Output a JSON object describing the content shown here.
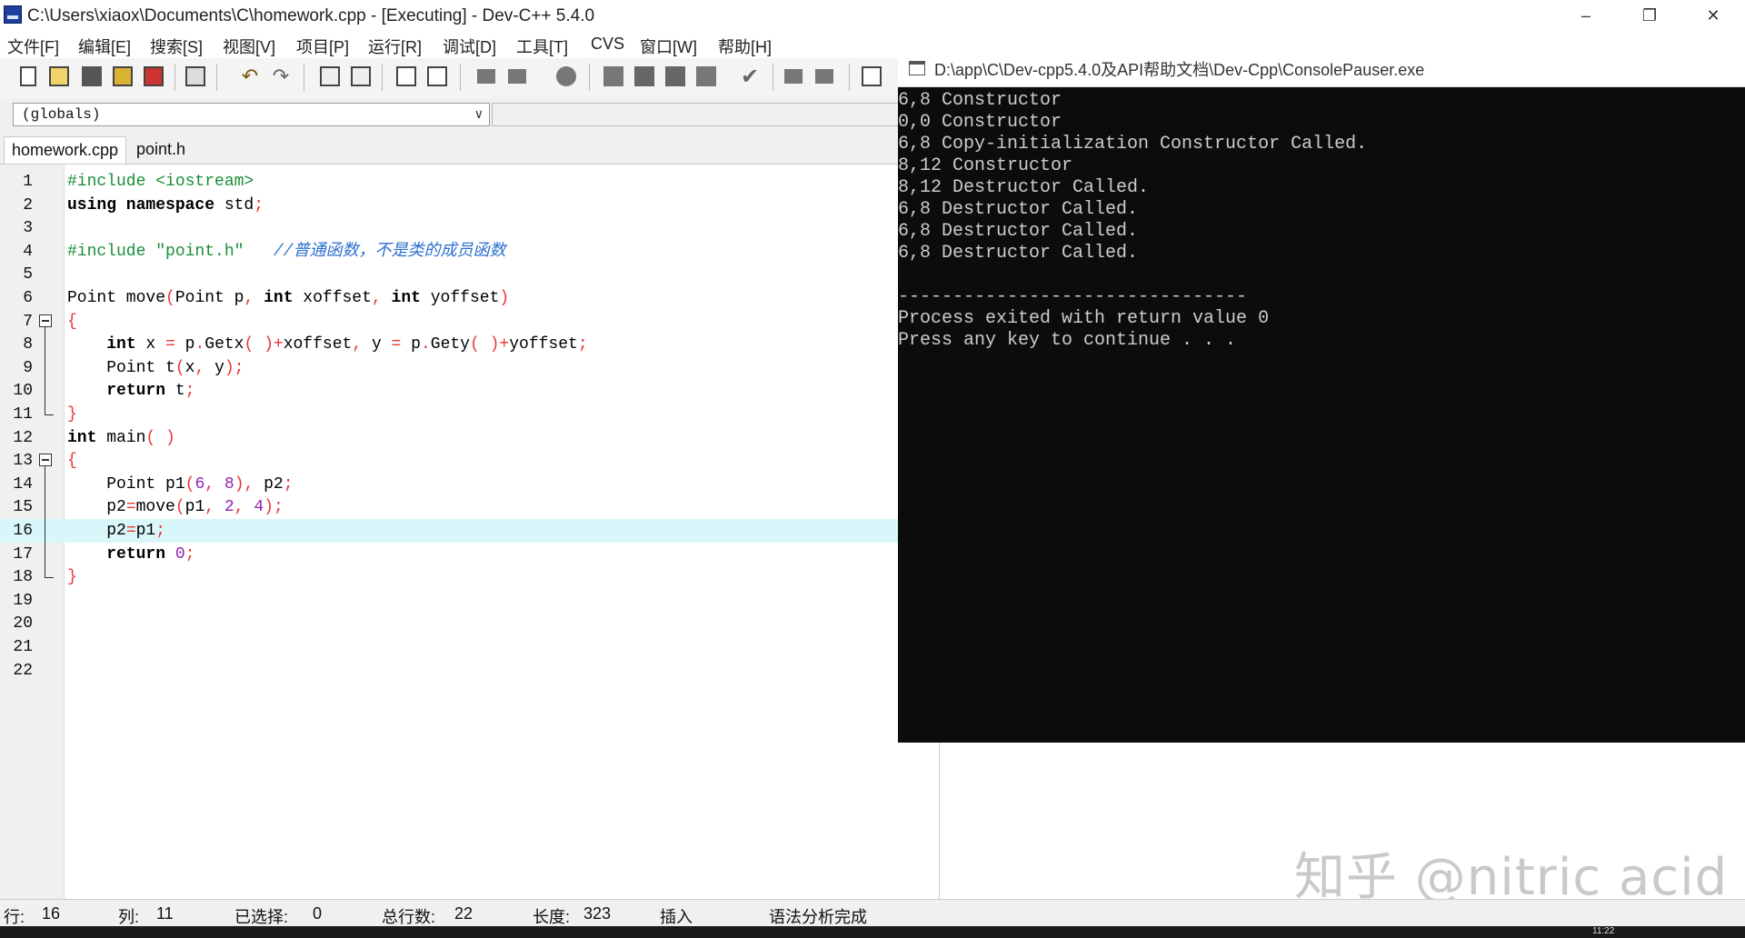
{
  "window": {
    "title": "C:\\Users\\xiaox\\Documents\\C\\homework.cpp - [Executing] - Dev-C++ 5.4.0",
    "icon": "devcpp-app-icon",
    "controls": [
      "minimize-icon",
      "restore-icon",
      "close-icon"
    ]
  },
  "menu": {
    "items": [
      "文件[F]",
      "编辑[E]",
      "搜索[S]",
      "视图[V]",
      "项目[P]",
      "运行[R]",
      "调试[D]",
      "工具[T]",
      "CVS",
      "窗口[W]",
      "帮助[H]"
    ]
  },
  "globals": {
    "value": "(globals)"
  },
  "tabs": [
    {
      "label": "homework.cpp",
      "active": true
    },
    {
      "label": "point.h",
      "active": false
    }
  ],
  "editor": {
    "lines": [
      {
        "n": "1",
        "segs": [
          [
            "pre",
            "#include <iostream>"
          ]
        ]
      },
      {
        "n": "2",
        "segs": [
          [
            "kw",
            "using namespace"
          ],
          [
            "txt",
            " std"
          ],
          [
            "op",
            ";"
          ]
        ]
      },
      {
        "n": "3",
        "segs": []
      },
      {
        "n": "4",
        "segs": [
          [
            "pre",
            "#include \"point.h\"   "
          ],
          [
            "cmt",
            "//普通函数，不是类的成员函数"
          ]
        ]
      },
      {
        "n": "5",
        "segs": []
      },
      {
        "n": "6",
        "segs": [
          [
            "txt",
            "Point move"
          ],
          [
            "op",
            "("
          ],
          [
            "txt",
            "Point p"
          ],
          [
            "op",
            ","
          ],
          [
            "txt",
            " "
          ],
          [
            "kw",
            "int"
          ],
          [
            "txt",
            " xoffset"
          ],
          [
            "op",
            ","
          ],
          [
            "txt",
            " "
          ],
          [
            "kw",
            "int"
          ],
          [
            "txt",
            " yoffset"
          ],
          [
            "op",
            ")"
          ]
        ]
      },
      {
        "n": "7",
        "fold": "open",
        "segs": [
          [
            "op",
            "{"
          ]
        ]
      },
      {
        "n": "8",
        "segs": [
          [
            "txt",
            "    "
          ],
          [
            "kw",
            "int"
          ],
          [
            "txt",
            " x "
          ],
          [
            "op",
            "="
          ],
          [
            "txt",
            " p"
          ],
          [
            "op",
            "."
          ],
          [
            "txt",
            "Getx"
          ],
          [
            "op",
            "( )+"
          ],
          [
            "txt",
            "xoffset"
          ],
          [
            "op",
            ","
          ],
          [
            "txt",
            " y "
          ],
          [
            "op",
            "="
          ],
          [
            "txt",
            " p"
          ],
          [
            "op",
            "."
          ],
          [
            "txt",
            "Gety"
          ],
          [
            "op",
            "( )+"
          ],
          [
            "txt",
            "yoffset"
          ],
          [
            "op",
            ";"
          ]
        ]
      },
      {
        "n": "9",
        "segs": [
          [
            "txt",
            "    Point t"
          ],
          [
            "op",
            "("
          ],
          [
            "txt",
            "x"
          ],
          [
            "op",
            ","
          ],
          [
            "txt",
            " y"
          ],
          [
            "op",
            ");"
          ]
        ]
      },
      {
        "n": "10",
        "segs": [
          [
            "txt",
            "    "
          ],
          [
            "kw",
            "return"
          ],
          [
            "txt",
            " t"
          ],
          [
            "op",
            ";"
          ]
        ]
      },
      {
        "n": "11",
        "fold": "end",
        "segs": [
          [
            "op",
            "}"
          ]
        ]
      },
      {
        "n": "12",
        "segs": [
          [
            "kw",
            "int"
          ],
          [
            "txt",
            " main"
          ],
          [
            "op",
            "( )"
          ]
        ]
      },
      {
        "n": "13",
        "fold": "open",
        "segs": [
          [
            "op",
            "{"
          ]
        ]
      },
      {
        "n": "14",
        "segs": [
          [
            "txt",
            "    Point p1"
          ],
          [
            "op",
            "("
          ],
          [
            "num",
            "6"
          ],
          [
            "op",
            ","
          ],
          [
            "txt",
            " "
          ],
          [
            "num",
            "8"
          ],
          [
            "op",
            "),"
          ],
          [
            "txt",
            " p2"
          ],
          [
            "op",
            ";"
          ]
        ]
      },
      {
        "n": "15",
        "segs": [
          [
            "txt",
            "    p2"
          ],
          [
            "op",
            "="
          ],
          [
            "txt",
            "move"
          ],
          [
            "op",
            "("
          ],
          [
            "txt",
            "p1"
          ],
          [
            "op",
            ","
          ],
          [
            "txt",
            " "
          ],
          [
            "num",
            "2"
          ],
          [
            "op",
            ","
          ],
          [
            "txt",
            " "
          ],
          [
            "num",
            "4"
          ],
          [
            "op",
            ");"
          ]
        ]
      },
      {
        "n": "16",
        "highlight": true,
        "segs": [
          [
            "txt",
            "    p2"
          ],
          [
            "op",
            "="
          ],
          [
            "txt",
            "p1"
          ],
          [
            "op",
            ";"
          ]
        ]
      },
      {
        "n": "17",
        "segs": [
          [
            "txt",
            "    "
          ],
          [
            "kw",
            "return"
          ],
          [
            "txt",
            " "
          ],
          [
            "num",
            "0"
          ],
          [
            "op",
            ";"
          ]
        ]
      },
      {
        "n": "18",
        "fold": "end",
        "segs": [
          [
            "op",
            "}"
          ]
        ]
      },
      {
        "n": "19",
        "segs": []
      },
      {
        "n": "20",
        "segs": []
      },
      {
        "n": "21",
        "segs": []
      },
      {
        "n": "22",
        "segs": []
      }
    ]
  },
  "console": {
    "title": "D:\\app\\C\\Dev-cpp5.4.0及API帮助文档\\Dev-Cpp\\ConsolePauser.exe",
    "lines": [
      "6,8 Constructor",
      "0,0 Constructor",
      "6,8 Copy-initialization Constructor Called.",
      "8,12 Constructor",
      "8,12 Destructor Called.",
      "6,8 Destructor Called.",
      "6,8 Destructor Called.",
      "6,8 Destructor Called.",
      "",
      "--------------------------------",
      "Process exited with return value 0",
      "Press any key to continue . . ."
    ]
  },
  "status": {
    "row_label": "行:",
    "row": "16",
    "col_label": "列:",
    "col": "11",
    "sel_label": "已选择:",
    "sel": "0",
    "total_label": "总行数:",
    "total": "22",
    "len_label": "长度:",
    "len": "323",
    "mode": "插入",
    "parse": "语法分析完成"
  },
  "taskbar": {
    "time": "11:22"
  },
  "watermark": "知乎 @nitric acid",
  "colors": {
    "preprocessor": "#1a8f3a",
    "operator": "#e33333",
    "number": "#8e27b3",
    "comment": "#2e6fce",
    "current_line": "#d9f7fb",
    "console_bg": "#0c0c0c",
    "console_text": "#cccccc"
  }
}
